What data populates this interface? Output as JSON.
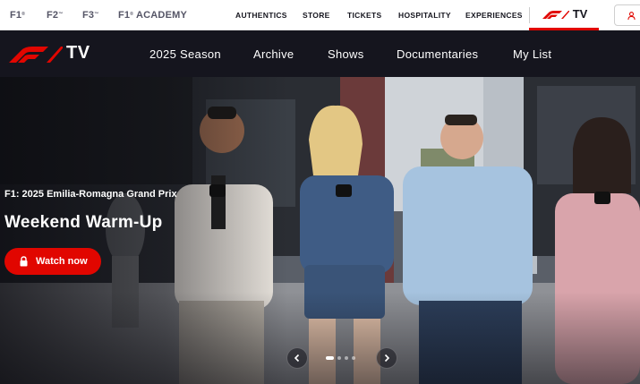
{
  "topbar": {
    "series": [
      {
        "label": "F1",
        "mark": "®"
      },
      {
        "label": "F2",
        "mark": "™"
      },
      {
        "label": "F3",
        "mark": "™"
      },
      {
        "label": "F1",
        "mark": "®",
        "suffix": " ACADEMY"
      }
    ],
    "links": [
      "AUTHENTICS",
      "STORE",
      "TICKETS",
      "HOSPITALITY",
      "EXPERIENCES"
    ],
    "tv_label": "TV"
  },
  "mainnav": {
    "brand_suffix": "TV",
    "links": [
      "2025 Season",
      "Archive",
      "Shows",
      "Documentaries",
      "My List"
    ]
  },
  "hero": {
    "subtitle": "F1: 2025 Emilia-Romagna Grand Prix",
    "title": "Weekend Warm-Up",
    "cta": "Watch now",
    "carousel": {
      "slides": 4,
      "active": 1
    }
  },
  "colors": {
    "brand_red": "#e10600",
    "dark": "#15151e",
    "white": "#ffffff"
  },
  "icons": [
    "f1-logo-icon",
    "user-icon",
    "lock-icon",
    "chevron-left-icon",
    "chevron-right-icon"
  ]
}
